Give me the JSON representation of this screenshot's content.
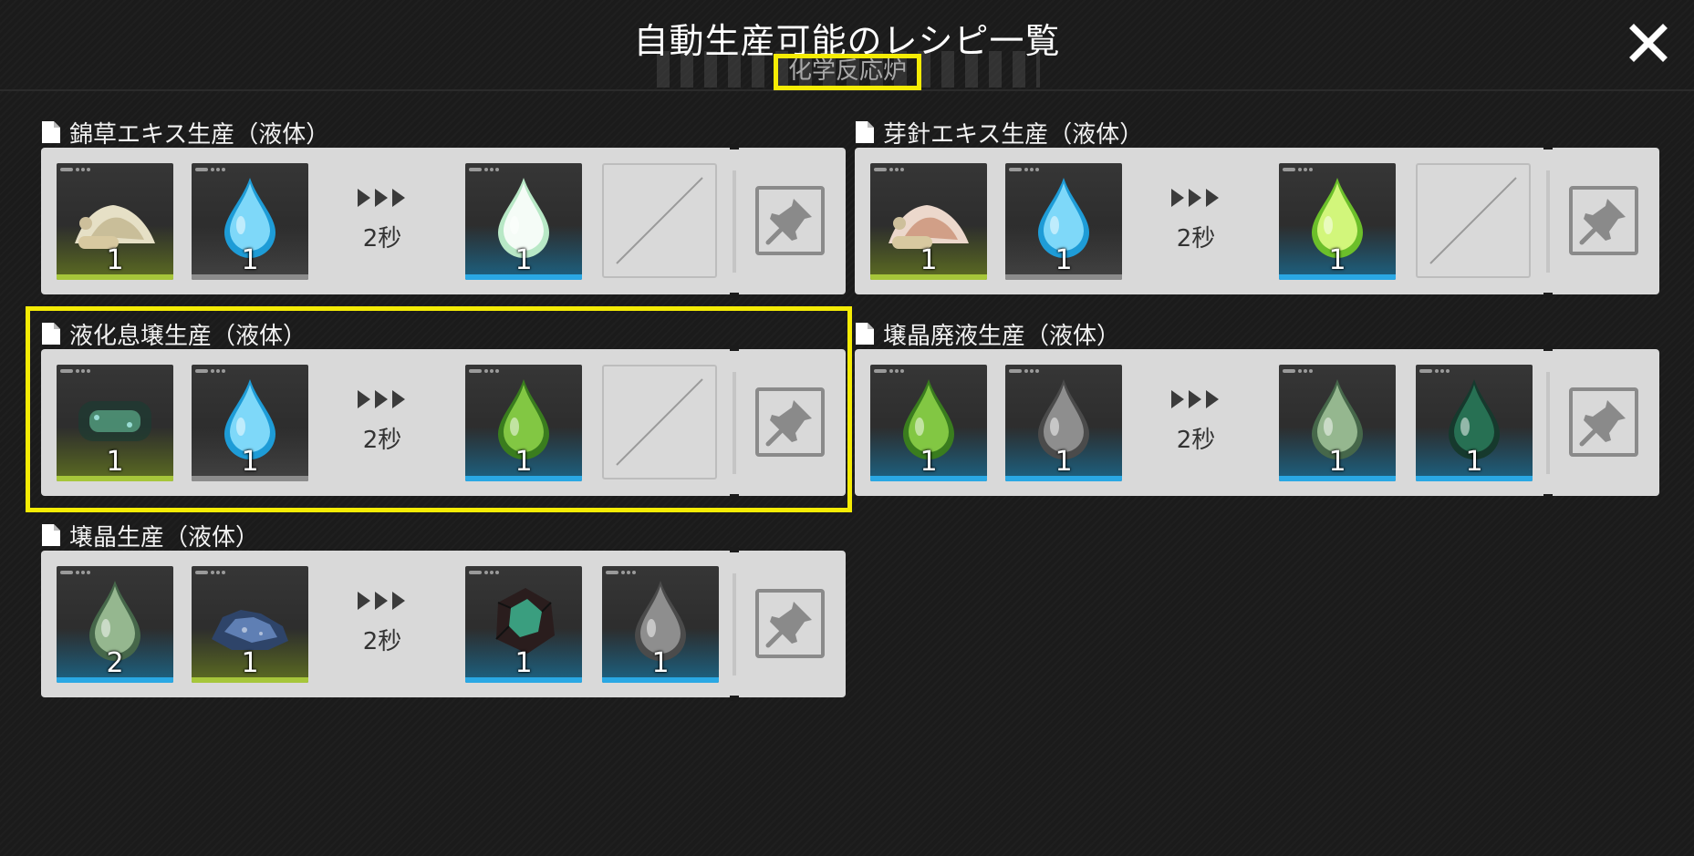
{
  "header": {
    "title": "自動生産可能のレシピ一覧",
    "subtitle": "化学反応炉"
  },
  "recipes": [
    {
      "name": "錦草エキス生産（液体）",
      "time": "2秒",
      "inputs": [
        {
          "item": "錦草の粉末",
          "qty": "1",
          "bar": "#a6c63a",
          "glow": "green"
        },
        {
          "item": "清水",
          "qty": "1",
          "bar": "#8c8c8c",
          "glow": "gray"
        }
      ],
      "outputs": [
        {
          "item": "錦草エキス",
          "qty": "1",
          "bar": "#2aa8e4",
          "glow": "blue"
        }
      ],
      "empty_outputs": 1
    },
    {
      "name": "芽針エキス生産（液体）",
      "time": "2秒",
      "inputs": [
        {
          "item": "芽針の粉末",
          "qty": "1",
          "bar": "#a6c63a",
          "glow": "green"
        },
        {
          "item": "清水",
          "qty": "1",
          "bar": "#8c8c8c",
          "glow": "gray"
        }
      ],
      "outputs": [
        {
          "item": "芽針エキス",
          "qty": "1",
          "bar": "#2aa8e4",
          "glow": "blue"
        }
      ],
      "empty_outputs": 1
    },
    {
      "name": "液化息壌生産（液体）",
      "time": "2秒",
      "inputs": [
        {
          "item": "息壌",
          "qty": "1",
          "bar": "#a6c63a",
          "glow": "green"
        },
        {
          "item": "清水",
          "qty": "1",
          "bar": "#8c8c8c",
          "glow": "gray"
        }
      ],
      "outputs": [
        {
          "item": "液化息壌",
          "qty": "1",
          "bar": "#2aa8e4",
          "glow": "blue"
        }
      ],
      "empty_outputs": 1
    },
    {
      "name": "壌晶廃液生産（液体）",
      "time": "2秒",
      "inputs": [
        {
          "item": "液化息壌",
          "qty": "1",
          "bar": "#2aa8e4",
          "glow": "blue"
        },
        {
          "item": "廃液",
          "qty": "1",
          "bar": "#2aa8e4",
          "glow": "blue"
        }
      ],
      "outputs": [
        {
          "item": "壌晶液",
          "qty": "1",
          "bar": "#2aa8e4",
          "glow": "blue"
        },
        {
          "item": "壌晶廃液",
          "qty": "1",
          "bar": "#2aa8e4",
          "glow": "blue"
        }
      ],
      "empty_outputs": 0
    },
    {
      "name": "壌晶生産（液体）",
      "time": "2秒",
      "inputs": [
        {
          "item": "壌晶液",
          "qty": "2",
          "bar": "#2aa8e4",
          "glow": "blue"
        },
        {
          "item": "青い鉱石",
          "qty": "1",
          "bar": "#a6c63a",
          "glow": "green"
        }
      ],
      "outputs": [
        {
          "item": "壌晶",
          "qty": "1",
          "bar": "#2aa8e4",
          "glow": "blue"
        },
        {
          "item": "廃液",
          "qty": "1",
          "bar": "#2aa8e4",
          "glow": "blue"
        }
      ],
      "empty_outputs": 0
    }
  ],
  "colors": {
    "highlight": "#f5ec05",
    "card_bg": "#d9d9d9",
    "blue_bar": "#2aa8e4",
    "green_bar": "#a6c63a",
    "gray_bar": "#8c8c8c"
  },
  "icons": {
    "close": "close-x-icon",
    "pin": "pin-icon",
    "document": "document-icon",
    "arrows": "triple-arrow-icon"
  }
}
